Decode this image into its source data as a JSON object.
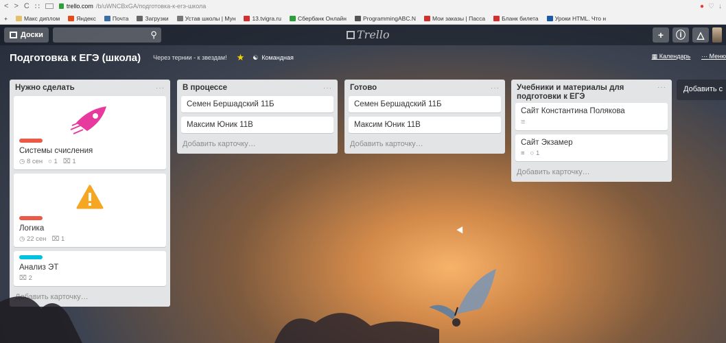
{
  "browser": {
    "url_host": "trello.com",
    "url_path": "/b/uWNCBxGA/подготовка-к-егэ-школа",
    "bookmarks": [
      {
        "label": "Макс диплом",
        "color": "#e1c26b"
      },
      {
        "label": "Яндекс",
        "color": "#e64a19"
      },
      {
        "label": "Почта",
        "color": "#3a6ea5"
      },
      {
        "label": "Загрузки",
        "color": "#666"
      },
      {
        "label": "Устав школы | Мун",
        "color": "#777"
      },
      {
        "label": "13.tvigra.ru",
        "color": "#d32f2f"
      },
      {
        "label": "Сбербанк Онлайн",
        "color": "#2e9e3a"
      },
      {
        "label": "ProgrammingABC.N",
        "color": "#555"
      },
      {
        "label": "Мои заказы | Пасса",
        "color": "#d32f2f"
      },
      {
        "label": "Бланк билета",
        "color": "#d32f2f"
      },
      {
        "label": "Уроки HTML. Что н",
        "color": "#1a5aa8"
      }
    ]
  },
  "header": {
    "boards_label": "Доски",
    "logo_text": "Trello"
  },
  "board": {
    "title": "Подготовка к ЕГЭ (школа)",
    "team": "Через тернии - к звездам!",
    "visibility": "Командная",
    "calendar": "Календарь",
    "menu": "Меню"
  },
  "lists": [
    {
      "title": "Нужно сделать",
      "cards": [
        {
          "cover": "rocket",
          "label_color": "#eb5a46",
          "title": "Системы счисления",
          "badges": [
            {
              "icon": "clock-icon",
              "text": "8 сен"
            },
            {
              "icon": "comment-icon",
              "text": "1"
            },
            {
              "icon": "attachment-icon",
              "text": "1"
            }
          ]
        },
        {
          "cover": "warning",
          "label_color": "#eb5a46",
          "title": "Логика",
          "badges": [
            {
              "icon": "clock-icon",
              "text": "22 сен"
            },
            {
              "icon": "attachment-icon",
              "text": "1"
            }
          ]
        },
        {
          "cover": "",
          "label_color": "#00c2e0",
          "title": "Анализ ЭТ",
          "badges": [
            {
              "icon": "attachment-icon",
              "text": "2"
            }
          ]
        }
      ],
      "add_label": "Добавить карточку…"
    },
    {
      "title": "В процессе",
      "cards": [
        {
          "title": "Семен Бершадский 11Б"
        },
        {
          "title": "Максим Юник 11В"
        }
      ],
      "add_label": "Добавить карточку…"
    },
    {
      "title": "Готово",
      "cards": [
        {
          "title": "Семен Бершадский 11Б"
        },
        {
          "title": "Максим Юник 11В"
        }
      ],
      "add_label": "Добавить карточку…"
    },
    {
      "title": "Учебники и материалы для подготовки к ЕГЭ",
      "cards": [
        {
          "title": "Сайт Константина Полякова",
          "desc": true
        },
        {
          "title": "Сайт Экзамер",
          "desc": true,
          "comments": "1"
        }
      ],
      "add_label": "Добавить карточку…"
    }
  ],
  "add_list_label": "Добавить с"
}
